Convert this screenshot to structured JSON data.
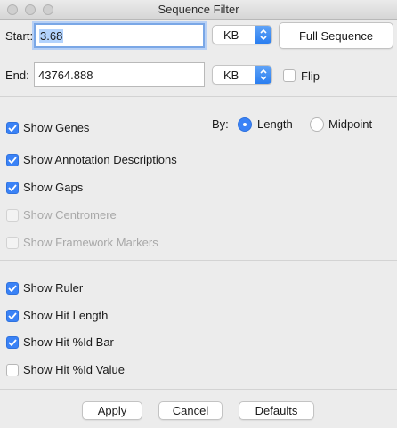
{
  "window": {
    "title": "Sequence Filter"
  },
  "range": {
    "start_label": "Start:",
    "start_value": "3.68",
    "start_unit": "KB",
    "full_sequence_label": "Full Sequence",
    "end_label": "End:",
    "end_value": "43764.888",
    "end_unit": "KB",
    "flip_label": "Flip",
    "flip_checked": false
  },
  "by": {
    "label": "By:",
    "options": [
      {
        "label": "Length",
        "selected": true
      },
      {
        "label": "Midpoint",
        "selected": false
      }
    ]
  },
  "features": [
    {
      "label": "Show Genes",
      "checked": true,
      "enabled": true
    },
    {
      "label": "Show Annotation Descriptions",
      "checked": true,
      "enabled": true
    },
    {
      "label": "Show Gaps",
      "checked": true,
      "enabled": true
    },
    {
      "label": "Show Centromere",
      "checked": false,
      "enabled": false
    },
    {
      "label": "Show Framework Markers",
      "checked": false,
      "enabled": false
    }
  ],
  "display": [
    {
      "label": "Show Ruler",
      "checked": true
    },
    {
      "label": "Show Hit Length",
      "checked": true
    },
    {
      "label": "Show Hit %Id Bar",
      "checked": true
    },
    {
      "label": "Show Hit %Id Value",
      "checked": false
    }
  ],
  "buttons": {
    "apply": "Apply",
    "cancel": "Cancel",
    "defaults": "Defaults"
  },
  "colors": {
    "accent": "#3a82f6",
    "selection": "#b3d3fd"
  }
}
